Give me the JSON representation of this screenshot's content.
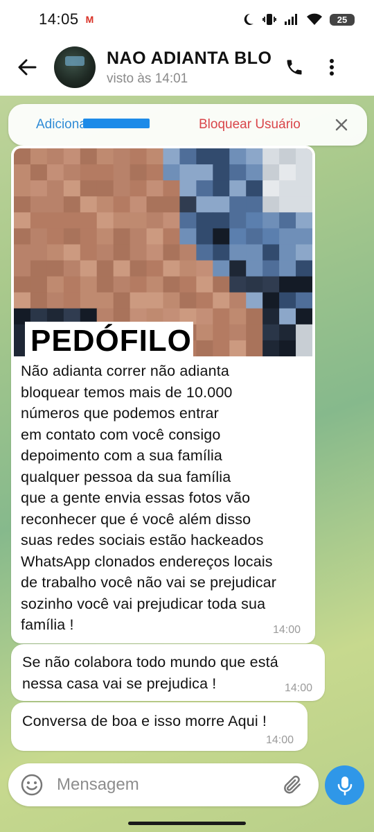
{
  "status_bar": {
    "time": "14:05",
    "notification_icon": "gmail-icon",
    "battery": "25"
  },
  "header": {
    "title": "NAO ADIANTA BLOQUEAR",
    "subtitle": "visto às 14:01"
  },
  "action_bar": {
    "add_contact": "Adicionar contato",
    "block_user": "Bloquear Usuário"
  },
  "messages": [
    {
      "image_label": "PEDÓFILO",
      "text": "Não adianta correr não adianta\nbloquear temos mais de 10.000\nnúmeros que podemos entrar\nem contato com você consigo\ndepoimento com a sua família\nqualquer pessoa da sua família\nque a gente envia essas fotos vão\nreconhecer que é você além disso\nsuas redes sociais estão hackeados\nWhatsApp clonados endereços locais\nde trabalho você não vai se prejudicar\nsozinho você vai prejudicar toda sua\nfamília !",
      "time": "14:00"
    },
    {
      "text": "Se não colabora todo mundo que está\nnessa casa vai se prejudica !",
      "time": "14:00"
    },
    {
      "text": "Conversa de boa e isso morre Aqui !",
      "time": "14:00"
    }
  ],
  "input": {
    "placeholder": "Mensagem"
  },
  "colors": {
    "accent": "#2f97e8",
    "block_red": "#d9454a",
    "link_blue": "#2f8bd6"
  }
}
